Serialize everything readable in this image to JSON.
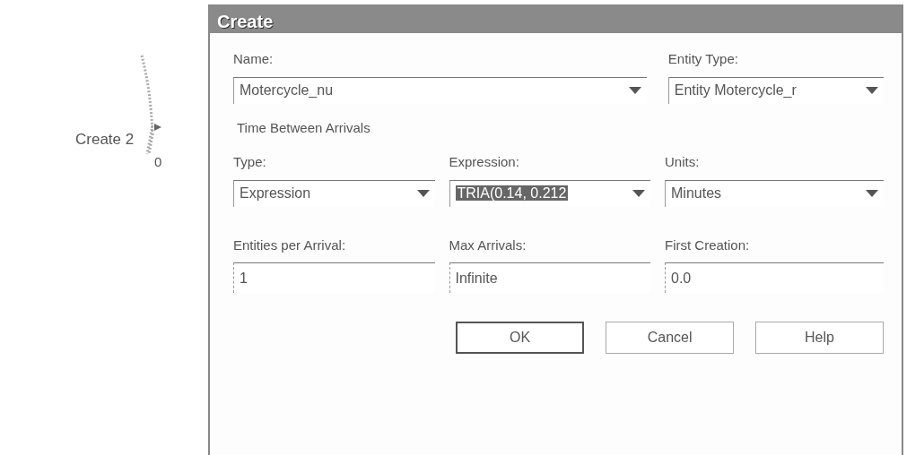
{
  "module": {
    "label": "Create 2",
    "counter": "0"
  },
  "window": {
    "title": "Create"
  },
  "fields": [
    {
      "label": "Name:",
      "kind": "combo",
      "value": "Motercycle_nu",
      "highlighted": false
    },
    {
      "label": "Entity Type:",
      "kind": "combo",
      "value": "Entity Motercycle_r",
      "highlighted": false
    }
  ],
  "group": {
    "title": "Time Between Arrivals"
  },
  "arrival_fields": [
    {
      "label": "Type:",
      "kind": "combo",
      "value": "Expression",
      "highlighted": false
    },
    {
      "label": "Expression:",
      "kind": "combo",
      "value": "TRIA(0.14, 0.212",
      "highlighted": true
    },
    {
      "label": "Units:",
      "kind": "combo",
      "value": "Minutes",
      "highlighted": false
    }
  ],
  "more_fields": [
    {
      "label": "Entities per Arrival:",
      "kind": "text",
      "value": "1",
      "highlighted": false
    },
    {
      "label": "Max Arrivals:",
      "kind": "text",
      "value": "Infinite",
      "highlighted": false
    },
    {
      "label": "First Creation:",
      "kind": "text",
      "value": "0.0",
      "highlighted": false
    }
  ],
  "buttons": [
    {
      "label": "OK",
      "default": true
    },
    {
      "label": "Cancel",
      "default": false
    },
    {
      "label": "Help",
      "default": false
    }
  ]
}
